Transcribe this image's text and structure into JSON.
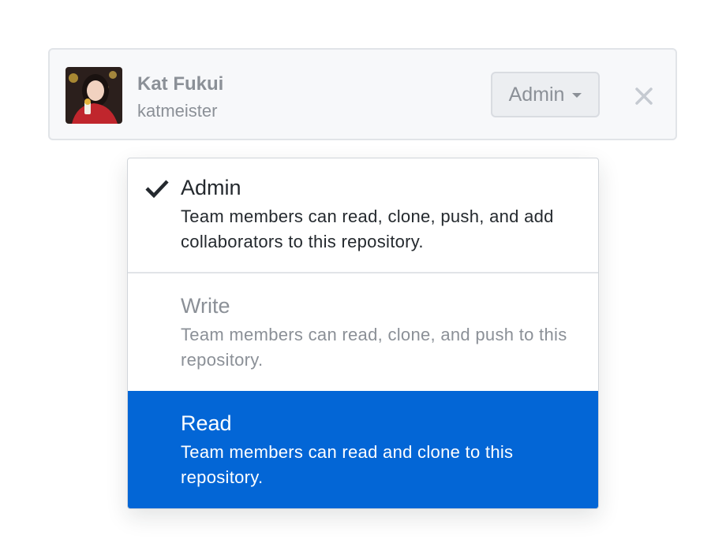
{
  "member": {
    "name": "Kat Fukui",
    "login": "katmeister",
    "avatar_icon": "user-avatar-photo",
    "role_button_label": "Admin",
    "caret_icon": "caret-down-icon",
    "remove_icon": "close-icon"
  },
  "role_menu": {
    "selected": "Admin",
    "highlighted": "Read",
    "check_icon": "check-icon",
    "items": [
      {
        "title": "Admin",
        "description": "Team members can read, clone, push, and add collaborators to this repository.",
        "state": "selected"
      },
      {
        "title": "Write",
        "description": "Team members can read, clone, and push to this repository.",
        "state": "disabled"
      },
      {
        "title": "Read",
        "description": "Team members can read and clone to this repository.",
        "state": "highlighted"
      }
    ]
  },
  "colors": {
    "highlight": "#0366d6",
    "muted_text": "#8b9097",
    "text": "#24292e",
    "card_background": "#f7f8fa"
  }
}
